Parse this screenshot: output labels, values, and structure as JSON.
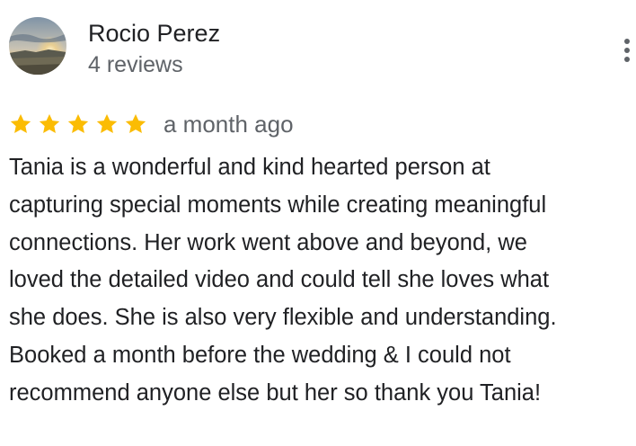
{
  "reviewer": {
    "name": "Rocio Perez",
    "review_count": "4 reviews",
    "avatar_icon": "profile-photo-sunset"
  },
  "menu": {
    "icon": "more-vert-icon"
  },
  "review": {
    "rating": 5,
    "max_rating": 5,
    "star_color": "#fbbc04",
    "date": "a month ago",
    "text_lines": [
      "Tania is a wonderful and kind hearted person at",
      "capturing special moments while creating meaningful",
      "connections. Her work went above and beyond, we",
      "loved the detailed video and could tell she loves what",
      "she does. She is also very flexible and understanding.",
      "Booked a month before the wedding & I could not",
      "recommend anyone else but her so thank you Tania!"
    ]
  }
}
